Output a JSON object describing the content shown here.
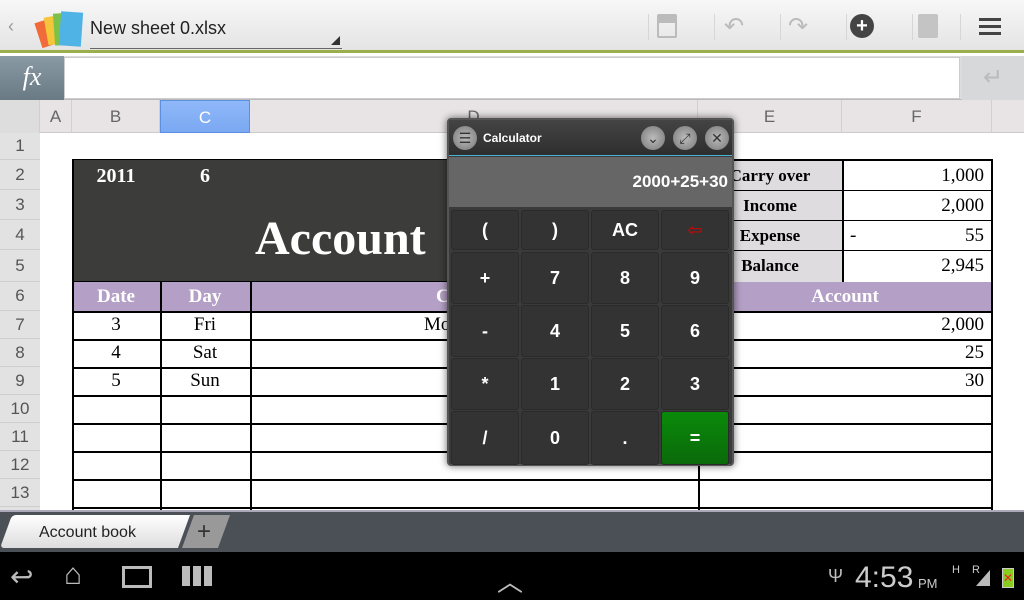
{
  "header": {
    "filename": "New sheet 0.xlsx",
    "icons": [
      "back-chevron-icon",
      "app-logo-icon",
      "save-icon",
      "undo-icon",
      "redo-icon",
      "add-icon",
      "find-replace-icon",
      "menu-icon"
    ]
  },
  "formula_bar": {
    "fx_label": "fx",
    "value": "",
    "enter_icon": "enter-icon"
  },
  "columns": [
    "A",
    "B",
    "C",
    "D",
    "E",
    "F"
  ],
  "selected_column": "C",
  "rows": [
    "1",
    "2",
    "3",
    "4",
    "5",
    "6",
    "7",
    "8",
    "9",
    "10",
    "11",
    "12",
    "13"
  ],
  "sheet": {
    "year": "2011",
    "month": "6",
    "title": "Account",
    "headers": {
      "date": "Date",
      "day": "Day",
      "contents": "C",
      "account": "Account"
    },
    "entries": [
      {
        "date": "3",
        "day": "Fri",
        "contents": "Mo",
        "account": "2,000"
      },
      {
        "date": "4",
        "day": "Sat",
        "contents": "",
        "account": "25"
      },
      {
        "date": "5",
        "day": "Sun",
        "contents": "",
        "account": "30"
      }
    ],
    "summary": [
      {
        "label": "Carry over",
        "sign": "",
        "value": "1,000"
      },
      {
        "label": "Income",
        "sign": "",
        "value": "2,000"
      },
      {
        "label": "Expense",
        "sign": "-",
        "value": "55"
      },
      {
        "label": "Balance",
        "sign": "",
        "value": "2,945"
      }
    ],
    "colors": {
      "dark_header": "#3c3d3b",
      "purple_header": "#b4a0c6",
      "label_bg": "#dedcdf"
    }
  },
  "calculator": {
    "title": "Calculator",
    "display": "2000+25+30",
    "keys": [
      [
        "(",
        ")",
        "AC",
        "⇦"
      ],
      [
        "+",
        "7",
        "8",
        "9"
      ],
      [
        "-",
        "4",
        "5",
        "6"
      ],
      [
        "*",
        "1",
        "2",
        "3"
      ],
      [
        "/",
        "0",
        ".",
        "="
      ]
    ],
    "equals_color": "#0a8a0a"
  },
  "tabs": {
    "sheet_tab": "Account book",
    "add": "+"
  },
  "status": {
    "time": "4:53",
    "ampm": "PM",
    "signal_h": "H",
    "signal_r": "R"
  }
}
